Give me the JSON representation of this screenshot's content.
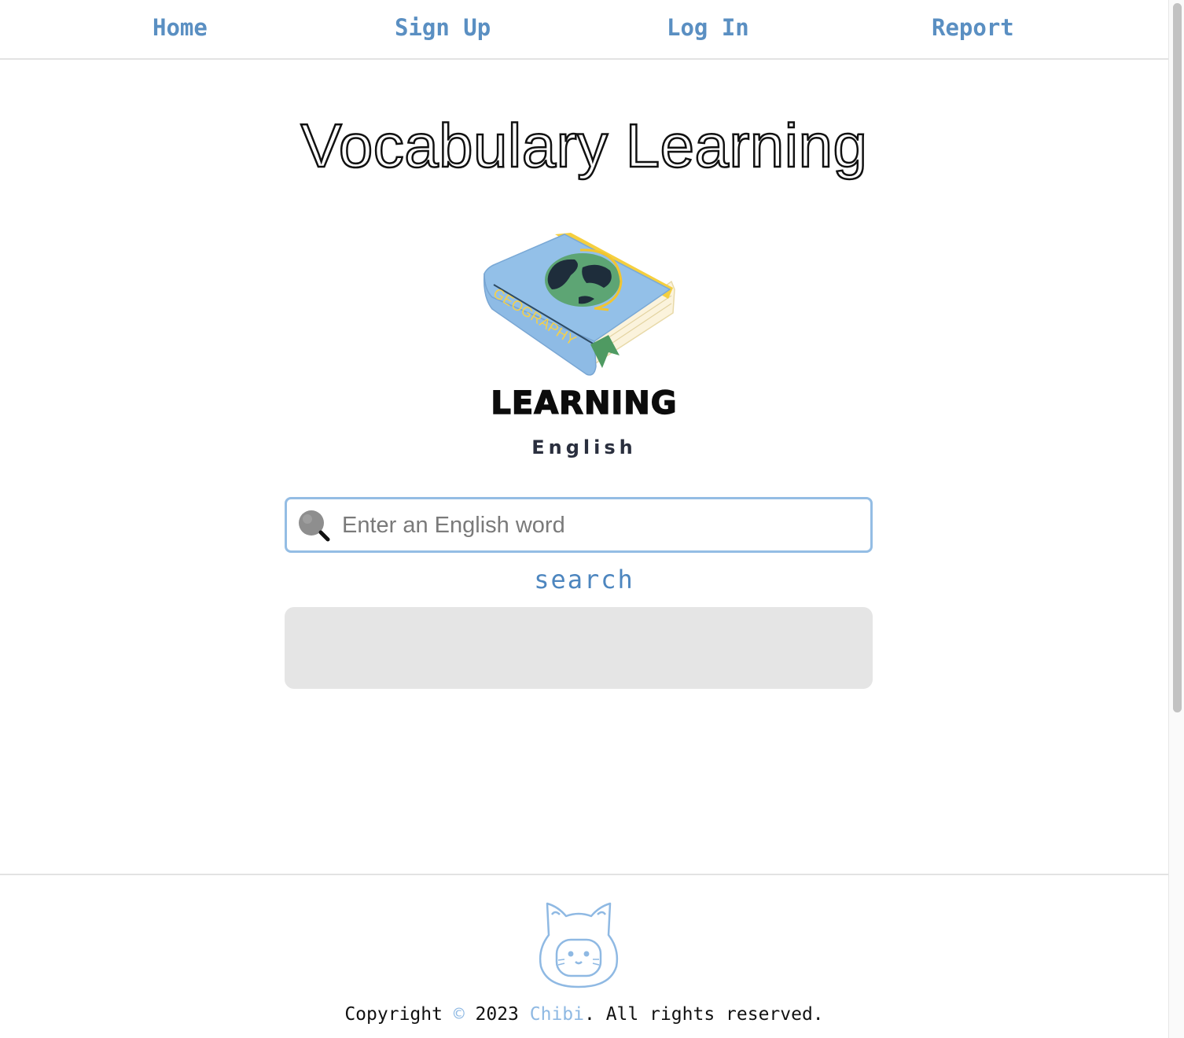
{
  "nav": {
    "home": "Home",
    "signup": "Sign Up",
    "login": "Log In",
    "report": "Report"
  },
  "title": "Vocabulary Learning",
  "logo": {
    "book_label": "GEOGRAPHY",
    "word": "LEARNING",
    "sub": "English"
  },
  "search": {
    "placeholder": "Enter an English word",
    "value": "",
    "button_label": "search"
  },
  "footer": {
    "copyright_prefix": "Copyright ",
    "copyright_symbol": "©",
    "year_text": " 2023 ",
    "brand": "Chibi",
    "suffix": ". All rights reserved."
  },
  "colors": {
    "nav_link": "#5a8fc2",
    "search_border": "#94bde4",
    "result_panel": "#e5e5e5",
    "accent": "#8fb9e3"
  },
  "icons": [
    "search-icon",
    "book-logo",
    "cat-logo-icon"
  ]
}
